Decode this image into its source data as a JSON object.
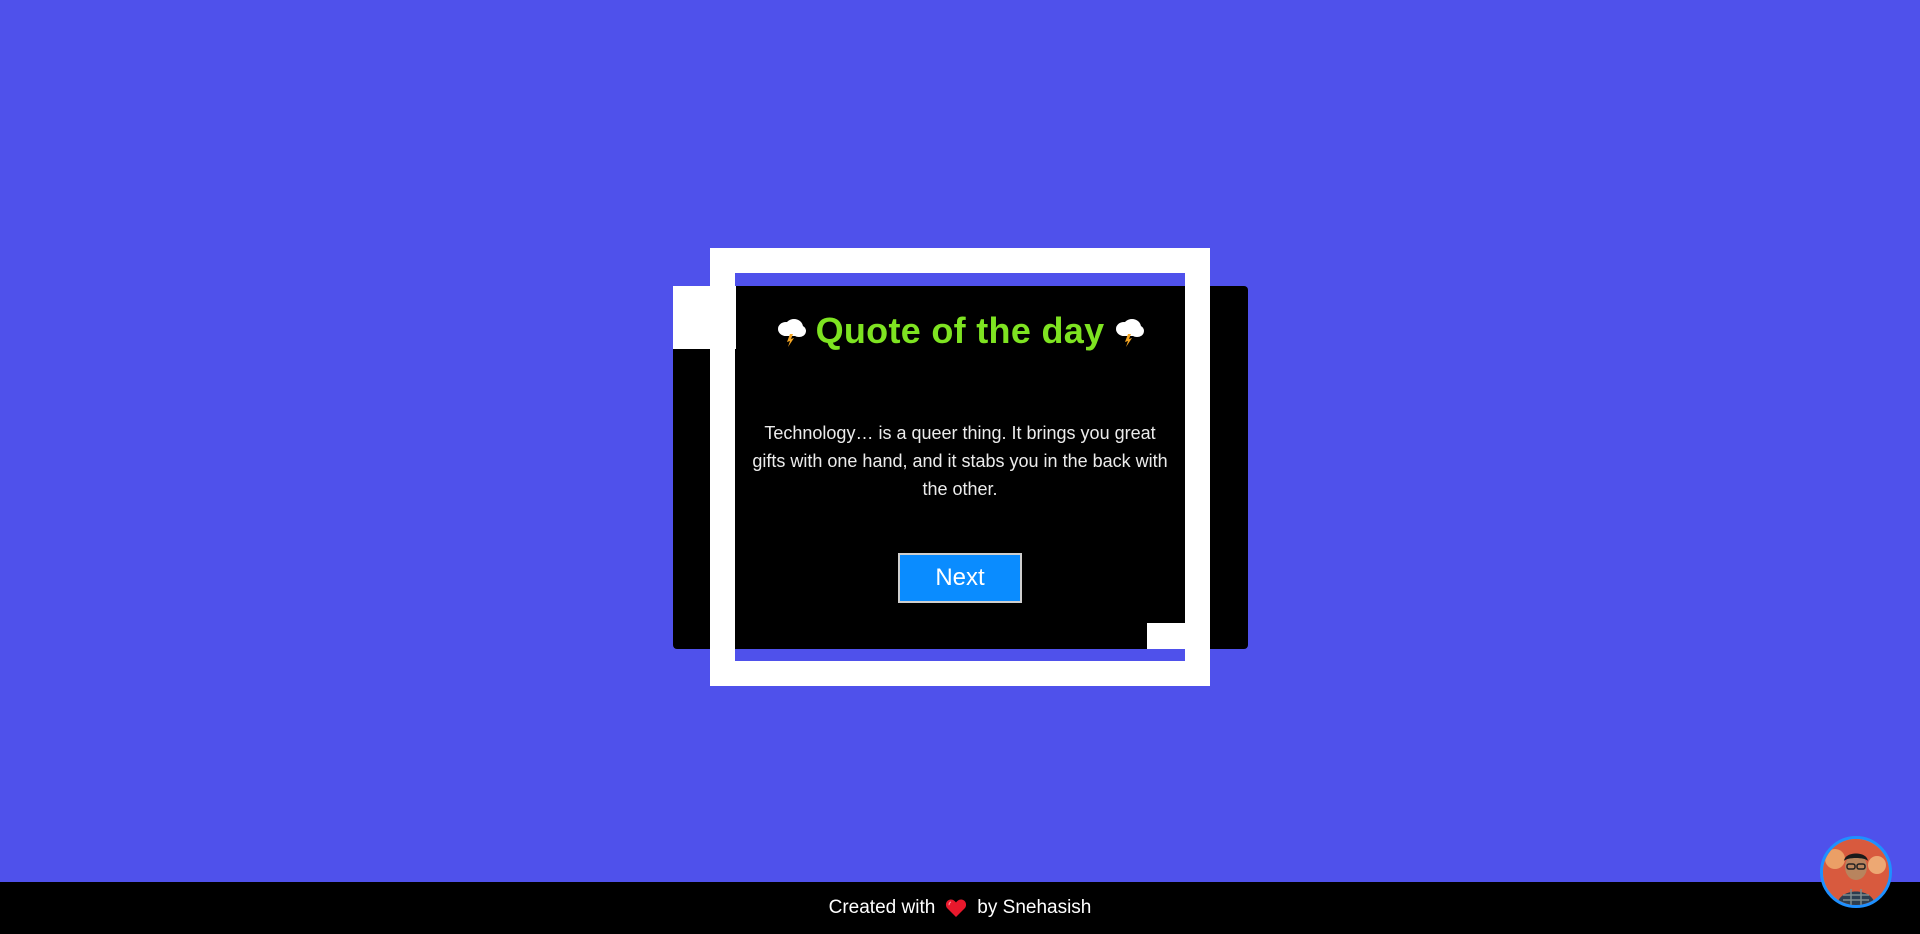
{
  "card": {
    "title": "Quote of the day",
    "quote": "Technology… is a queer thing. It brings you great gifts with one hand, and it stabs you in the back with the other.",
    "next_label": "Next",
    "title_icon": "cloud-lightning-icon"
  },
  "footer": {
    "prefix": "Created with",
    "suffix": "by Snehasish",
    "icon": "heart-icon"
  },
  "colors": {
    "background": "#4f51eb",
    "title": "#7ee321",
    "button": "#0a8cff",
    "heart": "#e8182c"
  }
}
